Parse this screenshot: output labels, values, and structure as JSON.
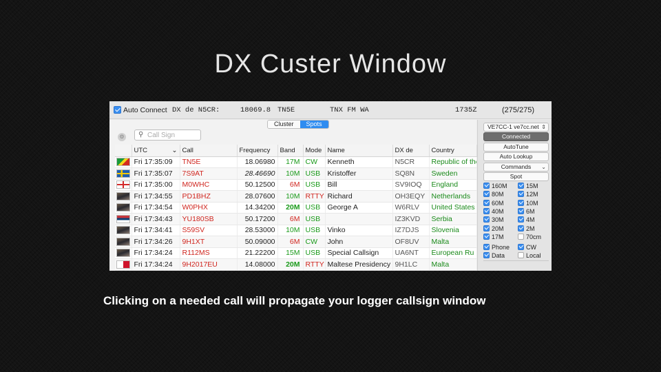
{
  "slide": {
    "title": "DX Custer Window",
    "caption": "Clicking on a needed call will propagate your logger callsign window"
  },
  "topbar": {
    "auto_connect_label": "Auto Connect",
    "dx_de": "DX de N5CR:",
    "frequency": "18069.8",
    "dx_call": "TN5E",
    "comment": "TNX FM WA",
    "utc": "1735Z",
    "count": "(275/275)"
  },
  "tabs": {
    "cluster": "Cluster",
    "spots": "Spots"
  },
  "search": {
    "placeholder": "Call Sign"
  },
  "table": {
    "headers": {
      "utc": "UTC",
      "call": "Call",
      "frequency": "Frequency",
      "band": "Band",
      "mode": "Mode",
      "name": "Name",
      "dx_de": "DX de",
      "country": "Country"
    },
    "rows": [
      {
        "flag": "congo",
        "utc": "Fri 17:35:09",
        "call": "TN5E",
        "frequency": "18.06980",
        "band": "17M",
        "mode": "CW",
        "name": "Kenneth",
        "dx_de": "N5CR",
        "country": "Republic of the"
      },
      {
        "flag": "sweden",
        "utc": "Fri 17:35:07",
        "call": "7S9AT",
        "frequency": "28.46690",
        "band": "10M",
        "mode": "USB",
        "name": "Kristoffer",
        "dx_de": "SQ8N",
        "country": "Sweden"
      },
      {
        "flag": "england",
        "utc": "Fri 17:35:00",
        "call": "M0WHC",
        "frequency": "50.12500",
        "band": "6M",
        "mode": "USB",
        "name": "Bill",
        "dx_de": "SV9IOQ",
        "country": "England"
      },
      {
        "flag": "photo",
        "utc": "Fri 17:34:55",
        "call": "PD1BHZ",
        "frequency": "28.07600",
        "band": "10M",
        "mode": "RTTY",
        "name": "Richard",
        "dx_de": "OH3EQY",
        "country": "Netherlands"
      },
      {
        "flag": "photo",
        "utc": "Fri 17:34:54",
        "call": "W0PHX",
        "frequency": "14.34200",
        "band": "20M",
        "mode": "USB",
        "name": "George A",
        "dx_de": "W6RLV",
        "country": "United States"
      },
      {
        "flag": "serbia",
        "utc": "Fri 17:34:43",
        "call": "YU180SB",
        "frequency": "50.17200",
        "band": "6M",
        "mode": "USB",
        "name": "",
        "dx_de": "IZ3KVD",
        "country": "Serbia"
      },
      {
        "flag": "photo",
        "utc": "Fri 17:34:41",
        "call": "S59SV",
        "frequency": "28.53000",
        "band": "10M",
        "mode": "USB",
        "name": "Vinko",
        "dx_de": "IZ7DJS",
        "country": "Slovenia"
      },
      {
        "flag": "photo",
        "utc": "Fri 17:34:26",
        "call": "9H1XT",
        "frequency": "50.09000",
        "band": "6M",
        "mode": "CW",
        "name": "John",
        "dx_de": "OF8UV",
        "country": "Malta"
      },
      {
        "flag": "photo",
        "utc": "Fri 17:34:24",
        "call": "R112MS",
        "frequency": "21.22200",
        "band": "15M",
        "mode": "USB",
        "name": "Special Callsign",
        "dx_de": "UA6NT",
        "country": "European Ru"
      },
      {
        "flag": "malta",
        "utc": "Fri 17:34:24",
        "call": "9H2017EU",
        "frequency": "14.08000",
        "band": "20M",
        "mode": "RTTY",
        "name": "Maltese Presidency",
        "dx_de": "9H1LC",
        "country": "Malta"
      }
    ]
  },
  "sidebar": {
    "server": "VE7CC-1 ve7cc.net",
    "connected": "Connected",
    "autotune": "AutoTune",
    "auto_lookup": "Auto Lookup",
    "commands": "Commands",
    "spot": "Spot",
    "bands": [
      {
        "label": "160M",
        "checked": true
      },
      {
        "label": "15M",
        "checked": true
      },
      {
        "label": "80M",
        "checked": true
      },
      {
        "label": "12M",
        "checked": true
      },
      {
        "label": "60M",
        "checked": true
      },
      {
        "label": "10M",
        "checked": true
      },
      {
        "label": "40M",
        "checked": true
      },
      {
        "label": "6M",
        "checked": true
      },
      {
        "label": "30M",
        "checked": true
      },
      {
        "label": "4M",
        "checked": true
      },
      {
        "label": "20M",
        "checked": true
      },
      {
        "label": "2M",
        "checked": true
      },
      {
        "label": "17M",
        "checked": true
      },
      {
        "label": "70cm",
        "checked": false
      }
    ],
    "modes": [
      {
        "label": "Phone",
        "checked": true
      },
      {
        "label": "CW",
        "checked": true
      },
      {
        "label": "Data",
        "checked": true
      },
      {
        "label": "Local",
        "checked": false
      }
    ]
  },
  "colors": {
    "call_red": "#d0261f",
    "country_green": "#1a8a1a",
    "accent_blue": "#2f8cf0"
  }
}
